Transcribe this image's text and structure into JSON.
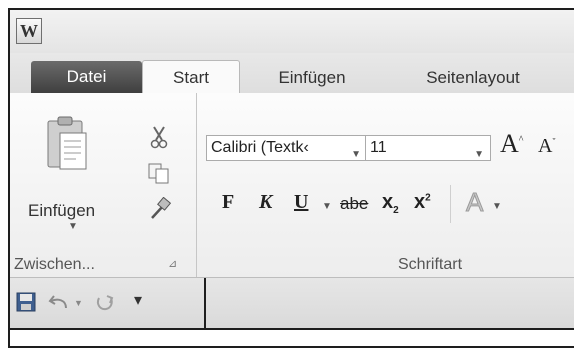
{
  "app": {
    "icon_letter": "W"
  },
  "tabs": [
    {
      "label": "Datei"
    },
    {
      "label": "Start"
    },
    {
      "label": "Einfügen"
    },
    {
      "label": "Seitenlayout"
    }
  ],
  "clipboard": {
    "paste_label": "Einfügen",
    "group_label": "Zwischen...",
    "icons": [
      "paste-icon",
      "cut-icon",
      "copy-icon",
      "format-painter-icon"
    ]
  },
  "font": {
    "font_name": "Calibri (Textk‹",
    "font_size": "11",
    "grow_label": "A",
    "shrink_label": "A",
    "bold_label": "F",
    "italic_label": "K",
    "underline_label": "U",
    "strike_label": "abe",
    "sub_label": "x",
    "sub_sub": "2",
    "sup_label": "x",
    "sup_sup": "2",
    "effects_label": "A",
    "group_label": "Schriftart"
  },
  "quick_access": {
    "icons": [
      "save-icon",
      "undo-icon",
      "redo-icon",
      "customize-icon"
    ]
  }
}
